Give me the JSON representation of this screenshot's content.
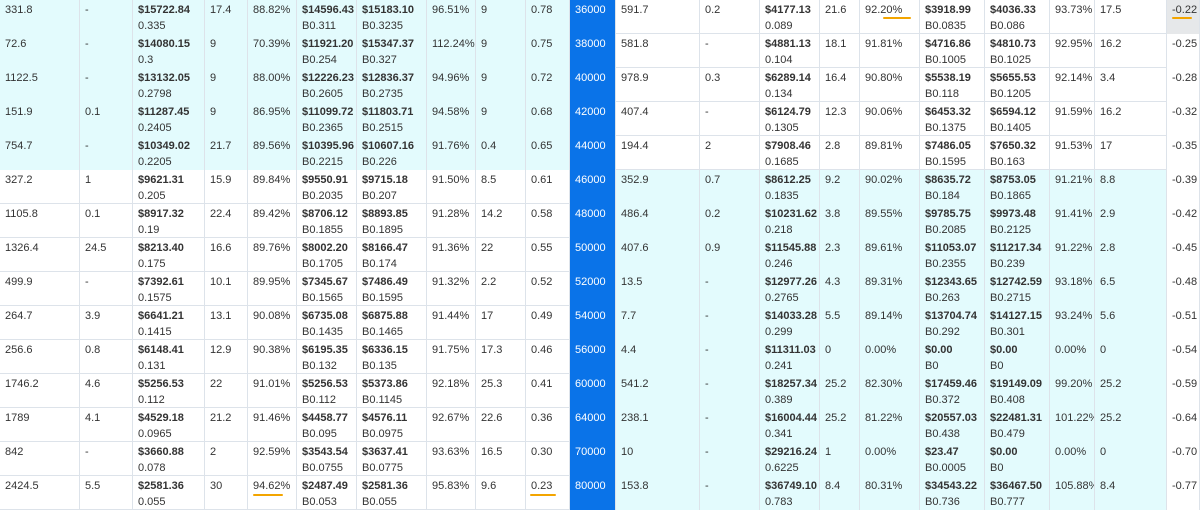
{
  "colors": {
    "call_row_bg": "#e3fbfd",
    "put_row_bg": "#e3fbfd",
    "strike_bg": "#0a73e8",
    "strike_text": "#ffffff",
    "last_col_bg": "#eef0f2",
    "annotation": "#f3a500"
  },
  "rows": [
    {
      "c": [
        "331.8",
        "-",
        "$15722.84",
        "0.335",
        "17.4",
        "88.82%",
        "$14596.43",
        "B0.311",
        "$15183.10",
        "B0.3235",
        "96.51%",
        "9",
        "0.78",
        "36000",
        "591.7",
        "0.2",
        "$4177.13",
        "0.089",
        "21.6",
        "92.20%",
        "$3918.99",
        "B0.0835",
        "$4036.33",
        "B0.086",
        "93.73%",
        "17.5",
        "-0.22"
      ]
    },
    {
      "c": [
        "72.6",
        "-",
        "$14080.15",
        "0.3",
        "9",
        "70.39%",
        "$11921.20",
        "B0.254",
        "$15347.37",
        "B0.327",
        "112.24%",
        "9",
        "0.75",
        "38000",
        "581.8",
        "-",
        "$4881.13",
        "0.104",
        "18.1",
        "91.81%",
        "$4716.86",
        "B0.1005",
        "$4810.73",
        "B0.1025",
        "92.95%",
        "16.2",
        "-0.25"
      ]
    },
    {
      "c": [
        "1122.5",
        "-",
        "$13132.05",
        "0.2798",
        "9",
        "88.00%",
        "$12226.23",
        "B0.2605",
        "$12836.37",
        "B0.2735",
        "94.96%",
        "9",
        "0.72",
        "40000",
        "978.9",
        "0.3",
        "$6289.14",
        "0.134",
        "16.4",
        "90.80%",
        "$5538.19",
        "B0.118",
        "$5655.53",
        "B0.1205",
        "92.14%",
        "3.4",
        "-0.28"
      ]
    },
    {
      "c": [
        "151.9",
        "0.1",
        "$11287.45",
        "0.2405",
        "9",
        "86.95%",
        "$11099.72",
        "B0.2365",
        "$11803.71",
        "B0.2515",
        "94.58%",
        "9",
        "0.68",
        "42000",
        "407.4",
        "-",
        "$6124.79",
        "0.1305",
        "12.3",
        "90.06%",
        "$6453.32",
        "B0.1375",
        "$6594.12",
        "B0.1405",
        "91.59%",
        "16.2",
        "-0.32"
      ]
    },
    {
      "c": [
        "754.7",
        "-",
        "$10349.02",
        "0.2205",
        "21.7",
        "89.56%",
        "$10395.96",
        "B0.2215",
        "$10607.16",
        "B0.226",
        "91.76%",
        "0.4",
        "0.65",
        "44000",
        "194.4",
        "2",
        "$7908.46",
        "0.1685",
        "2.8",
        "89.81%",
        "$7486.05",
        "B0.1595",
        "$7650.32",
        "B0.163",
        "91.53%",
        "17",
        "-0.35"
      ]
    },
    {
      "c": [
        "327.2",
        "1",
        "$9621.31",
        "0.205",
        "15.9",
        "89.84%",
        "$9550.91",
        "B0.2035",
        "$9715.18",
        "B0.207",
        "91.50%",
        "8.5",
        "0.61",
        "46000",
        "352.9",
        "0.7",
        "$8612.25",
        "0.1835",
        "9.2",
        "90.02%",
        "$8635.72",
        "B0.184",
        "$8753.05",
        "B0.1865",
        "91.21%",
        "8.8",
        "-0.39"
      ]
    },
    {
      "c": [
        "1105.8",
        "0.1",
        "$8917.32",
        "0.19",
        "22.4",
        "89.42%",
        "$8706.12",
        "B0.1855",
        "$8893.85",
        "B0.1895",
        "91.28%",
        "14.2",
        "0.58",
        "48000",
        "486.4",
        "0.2",
        "$10231.62",
        "0.218",
        "3.8",
        "89.55%",
        "$9785.75",
        "B0.2085",
        "$9973.48",
        "B0.2125",
        "91.41%",
        "2.9",
        "-0.42"
      ]
    },
    {
      "c": [
        "1326.4",
        "24.5",
        "$8213.40",
        "0.175",
        "16.6",
        "89.76%",
        "$8002.20",
        "B0.1705",
        "$8166.47",
        "B0.174",
        "91.36%",
        "22",
        "0.55",
        "50000",
        "407.6",
        "0.9",
        "$11545.88",
        "0.246",
        "2.3",
        "89.61%",
        "$11053.07",
        "B0.2355",
        "$11217.34",
        "B0.239",
        "91.22%",
        "2.8",
        "-0.45"
      ]
    },
    {
      "c": [
        "499.9",
        "-",
        "$7392.61",
        "0.1575",
        "10.1",
        "89.95%",
        "$7345.67",
        "B0.1565",
        "$7486.49",
        "B0.1595",
        "91.32%",
        "2.2",
        "0.52",
        "52000",
        "13.5",
        "-",
        "$12977.26",
        "0.2765",
        "4.3",
        "89.31%",
        "$12343.65",
        "B0.263",
        "$12742.59",
        "B0.2715",
        "93.18%",
        "6.5",
        "-0.48"
      ]
    },
    {
      "c": [
        "264.7",
        "3.9",
        "$6641.21",
        "0.1415",
        "13.1",
        "90.08%",
        "$6735.08",
        "B0.1435",
        "$6875.88",
        "B0.1465",
        "91.44%",
        "17",
        "0.49",
        "54000",
        "7.7",
        "-",
        "$14033.28",
        "0.299",
        "5.5",
        "89.14%",
        "$13704.74",
        "B0.292",
        "$14127.15",
        "B0.301",
        "93.24%",
        "5.6",
        "-0.51"
      ]
    },
    {
      "c": [
        "256.6",
        "0.8",
        "$6148.41",
        "0.131",
        "12.9",
        "90.38%",
        "$6195.35",
        "B0.132",
        "$6336.15",
        "B0.135",
        "91.75%",
        "17.3",
        "0.46",
        "56000",
        "4.4",
        "-",
        "$11311.03",
        "0.241",
        "0",
        "0.00%",
        "$0.00",
        "B0",
        "$0.00",
        "B0",
        "0.00%",
        "0",
        "-0.54"
      ]
    },
    {
      "c": [
        "1746.2",
        "4.6",
        "$5256.53",
        "0.112",
        "22",
        "91.01%",
        "$5256.53",
        "B0.112",
        "$5373.86",
        "B0.1145",
        "92.18%",
        "25.3",
        "0.41",
        "60000",
        "541.2",
        "-",
        "$18257.34",
        "0.389",
        "25.2",
        "82.30%",
        "$17459.46",
        "B0.372",
        "$19149.09",
        "B0.408",
        "99.20%",
        "25.2",
        "-0.59"
      ]
    },
    {
      "c": [
        "1789",
        "4.1",
        "$4529.18",
        "0.0965",
        "21.2",
        "91.46%",
        "$4458.77",
        "B0.095",
        "$4576.11",
        "B0.0975",
        "92.67%",
        "22.6",
        "0.36",
        "64000",
        "238.1",
        "-",
        "$16004.44",
        "0.341",
        "25.2",
        "81.22%",
        "$20557.03",
        "B0.438",
        "$22481.31",
        "B0.479",
        "101.22%",
        "25.2",
        "-0.64"
      ]
    },
    {
      "c": [
        "842",
        "-",
        "$3660.88",
        "0.078",
        "2",
        "92.59%",
        "$3543.54",
        "B0.0755",
        "$3637.41",
        "B0.0775",
        "93.63%",
        "16.5",
        "0.30",
        "70000",
        "10",
        "-",
        "$29216.24",
        "0.6225",
        "1",
        "0.00%",
        "$23.47",
        "B0.0005",
        "$0.00",
        "B0",
        "0.00%",
        "0",
        "-0.70"
      ]
    },
    {
      "c": [
        "2424.5",
        "5.5",
        "$2581.36",
        "0.055",
        "30",
        "94.62%",
        "$2487.49",
        "B0.053",
        "$2581.36",
        "B0.055",
        "95.83%",
        "9.6",
        "0.23",
        "80000",
        "153.8",
        "-",
        "$36749.10",
        "0.783",
        "8.4",
        "80.31%",
        "$34543.22",
        "B0.736",
        "$36467.50",
        "B0.777",
        "105.88%",
        "8.4",
        "-0.77"
      ]
    }
  ]
}
